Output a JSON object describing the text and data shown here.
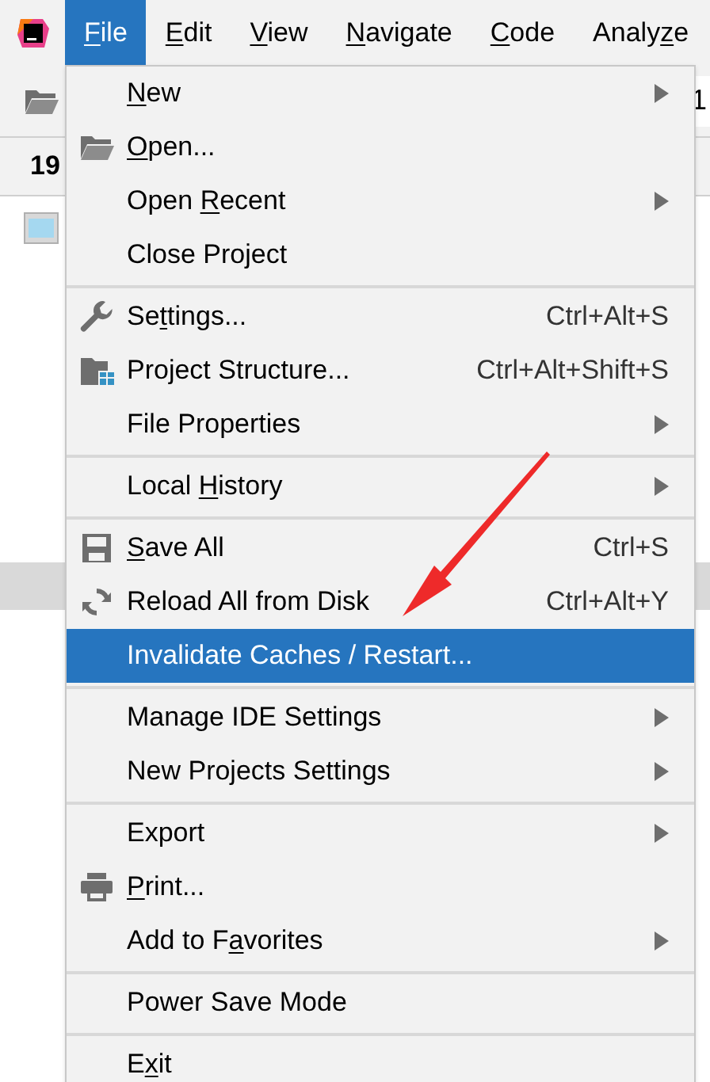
{
  "menu_bar": [
    {
      "key": "F",
      "post": "ile",
      "selected": true
    },
    {
      "key": "E",
      "post": "dit",
      "selected": false
    },
    {
      "key": "V",
      "post": "iew",
      "selected": false
    },
    {
      "key": "N",
      "post": "avigate",
      "selected": false
    },
    {
      "key": "C",
      "post": "ode",
      "selected": false
    },
    {
      "pre": "Analy",
      "key": "z",
      "post": "e",
      "selected": false
    }
  ],
  "background": {
    "toolbar_text": "1",
    "row_text": "19"
  },
  "file_menu": {
    "groups": [
      [
        {
          "key": "N",
          "post": "ew",
          "submenu": true,
          "selected": false
        },
        {
          "key": "O",
          "post": "pen...",
          "submenu": false,
          "selected": false
        },
        {
          "pre": "Open ",
          "key": "R",
          "post": "ecent",
          "submenu": true,
          "selected": false
        },
        {
          "pre": "Close Project",
          "submenu": false,
          "selected": false
        }
      ],
      [
        {
          "pre": "Se",
          "key": "t",
          "post": "tings...",
          "shortcut": "Ctrl+Alt+S",
          "submenu": false,
          "selected": false
        },
        {
          "pre": "Project Structure...",
          "shortcut": "Ctrl+Alt+Shift+S",
          "submenu": false,
          "selected": false
        },
        {
          "pre": "File Properties",
          "submenu": true,
          "selected": false
        }
      ],
      [
        {
          "pre": "Local ",
          "key": "H",
          "post": "istory",
          "submenu": true,
          "selected": false
        }
      ],
      [
        {
          "key": "S",
          "post": "ave All",
          "shortcut": "Ctrl+S",
          "submenu": false,
          "selected": false
        },
        {
          "pre": "Reload All from Disk",
          "shortcut": "Ctrl+Alt+Y",
          "submenu": false,
          "selected": false
        },
        {
          "pre": "Invalidate Caches / Restart...",
          "submenu": false,
          "selected": true
        }
      ],
      [
        {
          "pre": "Manage IDE Settings",
          "submenu": true,
          "selected": false
        },
        {
          "pre": "New Projects Settings",
          "submenu": true,
          "selected": false
        }
      ],
      [
        {
          "pre": "Export",
          "submenu": true,
          "selected": false
        },
        {
          "key": "P",
          "post": "rint...",
          "submenu": false,
          "selected": false
        },
        {
          "pre": "Add to F",
          "key": "a",
          "post": "vorites",
          "submenu": true,
          "selected": false
        }
      ],
      [
        {
          "pre": "Power Save Mode",
          "submenu": false,
          "selected": false
        }
      ],
      [
        {
          "pre": "E",
          "key": "x",
          "post": "it",
          "submenu": false,
          "selected": false
        }
      ]
    ]
  }
}
